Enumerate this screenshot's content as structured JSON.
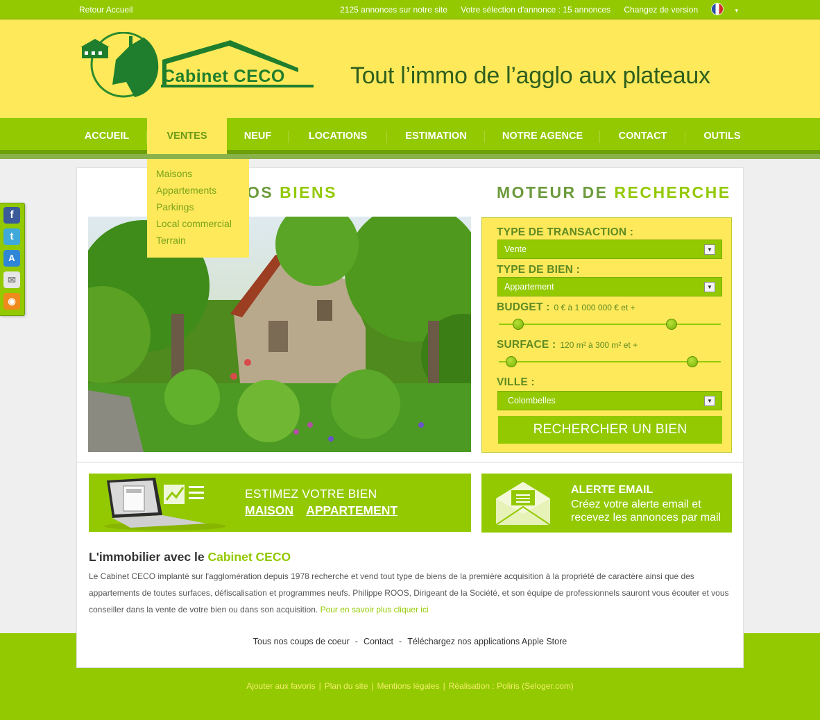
{
  "topbar": {
    "back_label": "Retour Accueil",
    "count_label": "2125 annonces sur notre site",
    "selection_label": "Votre sélection d'annonce :  15 annonces",
    "version_label": "Changez de version"
  },
  "header": {
    "logo_text": "Cabinet CECO",
    "tagline": "Tout l’immo de l’agglo aux plateaux"
  },
  "nav": {
    "items": [
      "ACCUEIL",
      "VENTES",
      "NEUF",
      "LOCATIONS",
      "ESTIMATION",
      "NOTRE AGENCE",
      "CONTACT",
      "OUTILS"
    ],
    "active": "VENTES"
  },
  "dropdown": {
    "items": [
      "Maisons",
      "Appartements",
      "Parkings",
      "Local commercial",
      "Terrain"
    ]
  },
  "social": {
    "icons": [
      "facebook-icon",
      "twitter-icon",
      "app-store-icon",
      "mail-icon",
      "rss-icon"
    ]
  },
  "sections": {
    "biens_prefix": "OS",
    "biens_accent": "BIENS",
    "moteur_prefix": "MOTEUR DE",
    "moteur_accent": "RECHERCHE"
  },
  "search": {
    "transaction_label": "TYPE DE TRANSACTION :",
    "transaction_value": "Vente",
    "bien_label": "TYPE DE BIEN :",
    "bien_value": "Appartement",
    "budget_label": "BUDGET :",
    "budget_range": "0 € à 1 000 000 € et +",
    "surface_label": "SURFACE :",
    "surface_range": "120 m² à 300 m² et +",
    "ville_label": "VILLE :",
    "ville_value": "Colombelles",
    "button_label": "RECHERCHER UN BIEN"
  },
  "estimate": {
    "title": "ESTIMEZ VOTRE BIEN",
    "link_maison": "MAISON",
    "link_appartement": "APPARTEMENT"
  },
  "alert": {
    "title": "ALERTE EMAIL",
    "text": "Créez votre alerte email et recevez les annonces par mail"
  },
  "about": {
    "heading_prefix": "L'immobilier avec le",
    "heading_accent": "Cabinet CECO",
    "text": "Le Cabinet CECO implanté sur l'agglomération depuis 1978 recherche et vend tout type de biens de la première acquisition à la propriété de caractère ainsi que des appartements de toutes surfaces, défiscalisation et programmes neufs. Philippe ROOS, Dirigeant de la Société, et son équipe de professionnels sauront vous écouter et vous conseiller dans la vente de votre bien ou dans son acquisition.",
    "link": "Pour en savoir plus cliquer ici"
  },
  "footer": {
    "links": [
      "Tous nos coups de coeur",
      "Contact",
      "Téléchargez nos applications Apple Store"
    ],
    "credits": [
      "Ajouter aux favoris",
      "Plan du site",
      "Mentions légales",
      "Réalisation : Poliris (Seloger.com)"
    ]
  },
  "colors": {
    "green": "#93c900",
    "yellow": "#fde95a",
    "dark_green": "#1f7e2d"
  }
}
